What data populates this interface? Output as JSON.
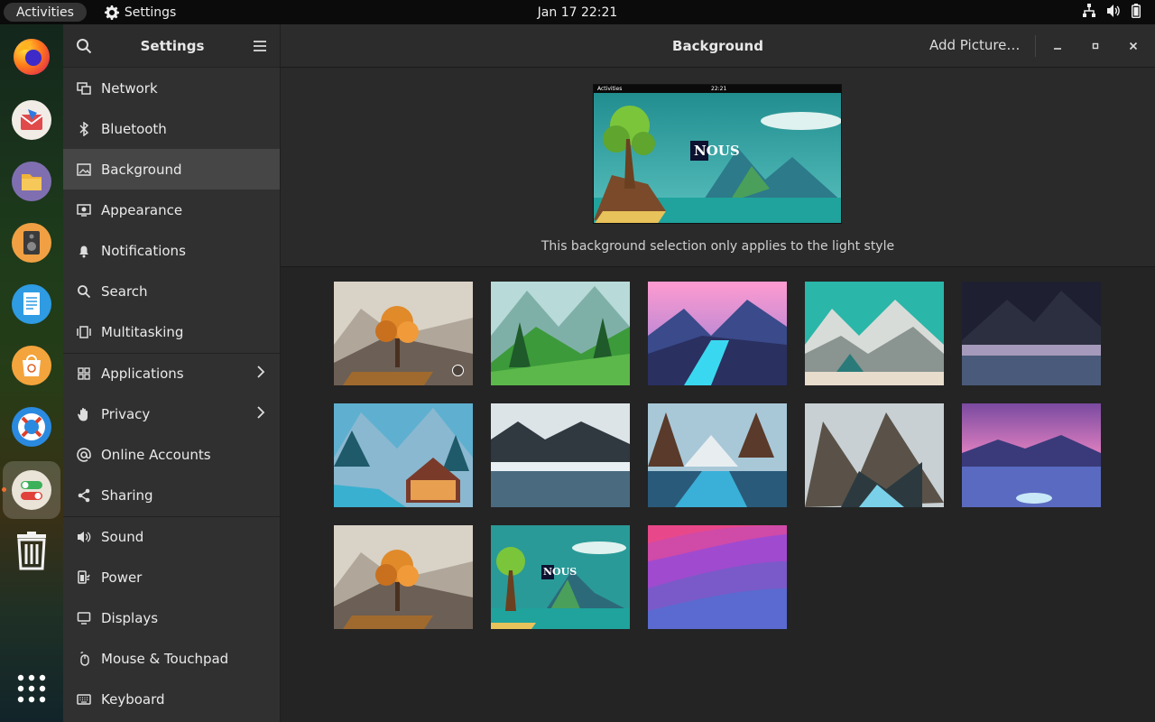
{
  "topbar": {
    "activities": "Activities",
    "app_name": "Settings",
    "clock": "Jan 17  22:21"
  },
  "dock": {
    "apps": [
      "firefox-icon",
      "mail-icon",
      "files-icon",
      "rhythmbox-icon",
      "writer-icon",
      "app-center-icon",
      "help-icon",
      "settings-app-icon",
      "trash-icon",
      "show-apps-icon"
    ]
  },
  "sidebar": {
    "title": "Settings",
    "items": [
      {
        "label": "Network"
      },
      {
        "label": "Bluetooth"
      },
      {
        "label": "Background"
      },
      {
        "label": "Appearance"
      },
      {
        "label": "Notifications"
      },
      {
        "label": "Search"
      },
      {
        "label": "Multitasking"
      },
      {
        "label": "Applications"
      },
      {
        "label": "Privacy"
      },
      {
        "label": "Online Accounts"
      },
      {
        "label": "Sharing"
      },
      {
        "label": "Sound"
      },
      {
        "label": "Power"
      },
      {
        "label": "Displays"
      },
      {
        "label": "Mouse & Touchpad"
      },
      {
        "label": "Keyboard"
      }
    ],
    "selected": "Background"
  },
  "main": {
    "title": "Background",
    "add_picture": "Add Picture…",
    "preview": {
      "bar_left": "Activities",
      "bar_clock": "22:21",
      "logo_text": "NOUS"
    },
    "caption": "This background selection only applies to the light style",
    "wallpapers": [
      {
        "name": "autumn-tree",
        "selected": true
      },
      {
        "name": "green-mountains"
      },
      {
        "name": "pink-sky-river"
      },
      {
        "name": "tent-mountains"
      },
      {
        "name": "dark-mountain-mist"
      },
      {
        "name": "cabin-waterfall"
      },
      {
        "name": "frozen-lake"
      },
      {
        "name": "canyon-river"
      },
      {
        "name": "rocky-valley"
      },
      {
        "name": "purple-ice-field"
      },
      {
        "name": "autumn-tree-2"
      },
      {
        "name": "nous-island",
        "logo_text": "NOUS"
      },
      {
        "name": "purple-waves"
      }
    ]
  }
}
